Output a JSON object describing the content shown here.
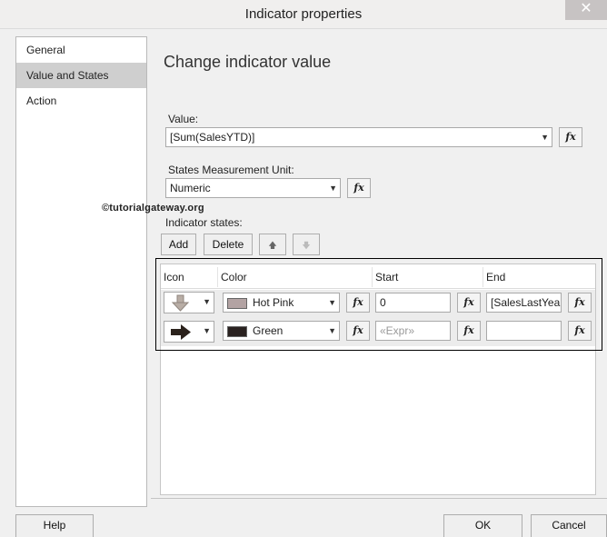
{
  "window": {
    "title": "Indicator properties",
    "close_label": "✕"
  },
  "nav": {
    "items": [
      {
        "label": "General",
        "selected": false
      },
      {
        "label": "Value and States",
        "selected": true
      },
      {
        "label": "Action",
        "selected": false
      }
    ]
  },
  "main": {
    "heading": "Change indicator value",
    "value_label": "Value:",
    "value": "[Sum(SalesYTD)]",
    "unit_label": "States Measurement Unit:",
    "unit_value": "Numeric",
    "states_label": "Indicator states:",
    "fx_label": "fx"
  },
  "watermark": "©tutorialgateway.org",
  "toolbar": {
    "add": "Add",
    "delete": "Delete",
    "up_arrow": "🡅",
    "down_arrow": "🡇"
  },
  "grid": {
    "headers": {
      "icon": "Icon",
      "color": "Color",
      "start": "Start",
      "end": "End"
    },
    "rows": [
      {
        "icon": "arrow-down-icon",
        "color_name": "Hot Pink",
        "color_hex": "#b3a3a3",
        "start": "0",
        "start_placeholder": "",
        "end": "[SalesLastYear]"
      },
      {
        "icon": "arrow-right-icon",
        "color_name": "Green",
        "color_hex": "#2a2220",
        "start": "",
        "start_placeholder": "«Expr»",
        "end": ""
      }
    ]
  },
  "footer": {
    "help": "Help",
    "ok": "OK",
    "cancel": "Cancel"
  }
}
